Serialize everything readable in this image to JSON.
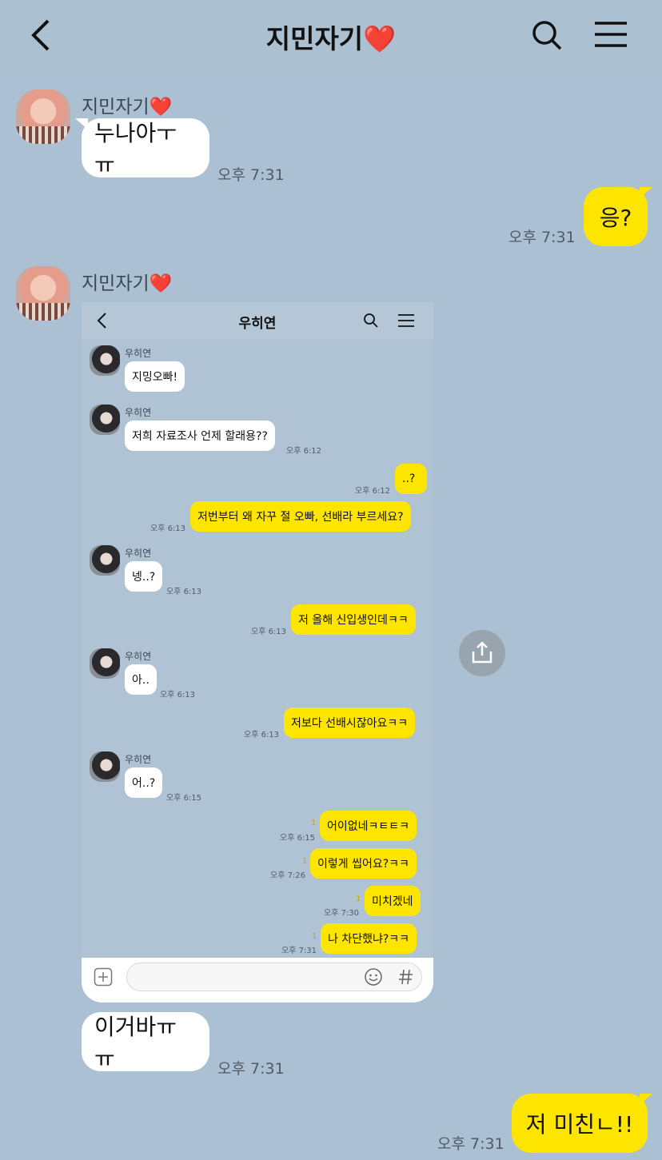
{
  "header": {
    "title": "지민자기",
    "heart": "❤️"
  },
  "messages": [
    {
      "sender": "지민자기",
      "text": "누나아ㅜㅠ",
      "time": "오후 7:31"
    },
    {
      "text": "응?",
      "time": "오후 7:31"
    },
    {
      "sender": "지민자기"
    },
    {
      "text": "이거바ㅠㅠ",
      "time": "오후 7:31"
    },
    {
      "text": "저 미친ㄴ!!",
      "time": "오후 7:31"
    }
  ],
  "screenshot": {
    "title": "우히연",
    "sender": "우히연",
    "msgs": [
      {
        "text": "지밍오빠!"
      },
      {
        "text": "저희 자료조사 언제 할래용??",
        "time": "오후 6:12"
      },
      {
        "text": "..?",
        "time": "오후 6:12"
      },
      {
        "text": "저번부터 왜 자꾸 절 오빠, 선배라 부르세요?",
        "time": "오후 6:13"
      },
      {
        "text": "넹..?",
        "time": "오후 6:13"
      },
      {
        "text": "저 올해 신입생인데ㅋㅋ",
        "time": "오후 6:13"
      },
      {
        "text": "아..",
        "time": "오후 6:13"
      },
      {
        "text": "저보다 선배시잖아요ㅋㅋ",
        "time": "오후 6:13"
      },
      {
        "text": "어..?",
        "time": "오후 6:15"
      },
      {
        "text": "어이없네ㅋㅌㅌㅋ",
        "time": "오후 6:15",
        "unread": "1"
      },
      {
        "text": "이렇게 씹어요?ㅋㅋ",
        "time": "오후 7:26",
        "unread": "1"
      },
      {
        "text": "미치겠네",
        "time": "오후 7:30",
        "unread": "1"
      },
      {
        "text": "나 차단했냐?ㅋㅋ",
        "time": "오후 7:31",
        "unread": "1"
      }
    ]
  }
}
